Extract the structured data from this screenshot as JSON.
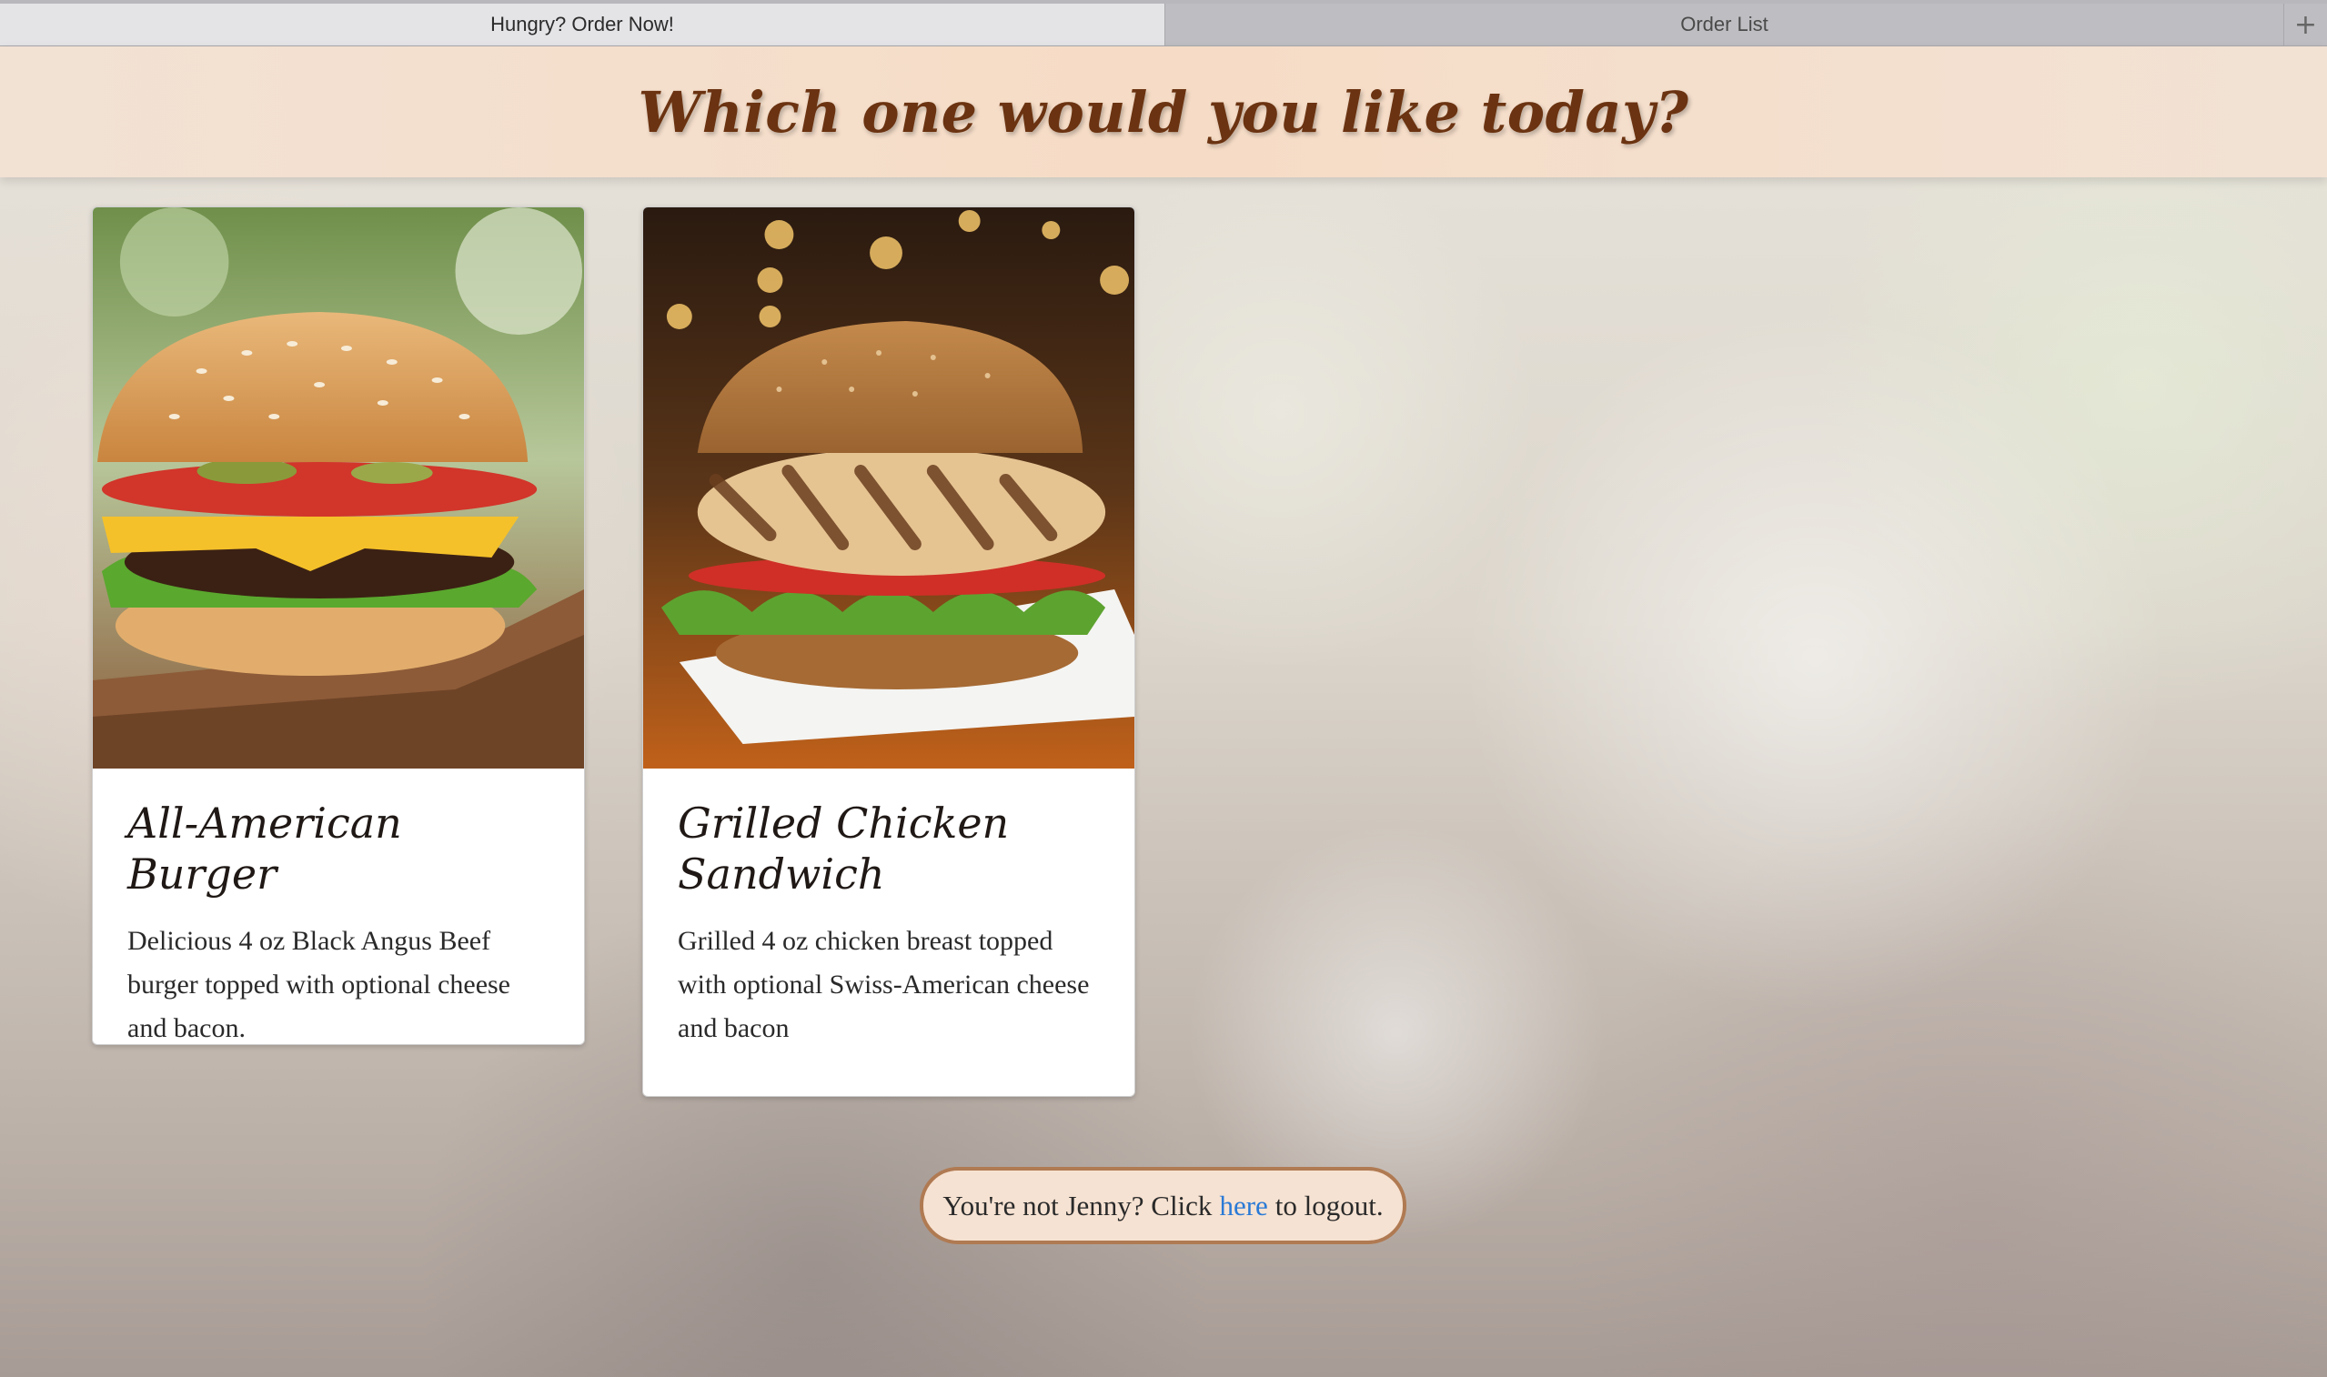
{
  "tabs": [
    {
      "label": "Hungry? Order Now!",
      "active": true
    },
    {
      "label": "Order List",
      "active": false
    }
  ],
  "tab_add_icon": "+",
  "header": {
    "title": "Which one would you like today?"
  },
  "menu": {
    "items": [
      {
        "title": "All-American Burger",
        "description": "Delicious 4 oz Black Angus Beef burger topped with optional cheese and bacon.",
        "image_icon": "beef-burger-photo"
      },
      {
        "title": "Grilled Chicken Sandwich",
        "description": "Grilled 4 oz chicken breast topped with optional Swiss-American cheese and bacon",
        "image_icon": "chicken-sandwich-photo"
      }
    ]
  },
  "logout": {
    "prefix": "You're not Jenny? Click",
    "link_label": "here",
    "suffix": "to logout."
  },
  "colors": {
    "title_brown": "#6b3311",
    "banner_bg": "#f6dcc6",
    "link_blue": "#2a7ad6",
    "pill_border": "#b07a52"
  }
}
